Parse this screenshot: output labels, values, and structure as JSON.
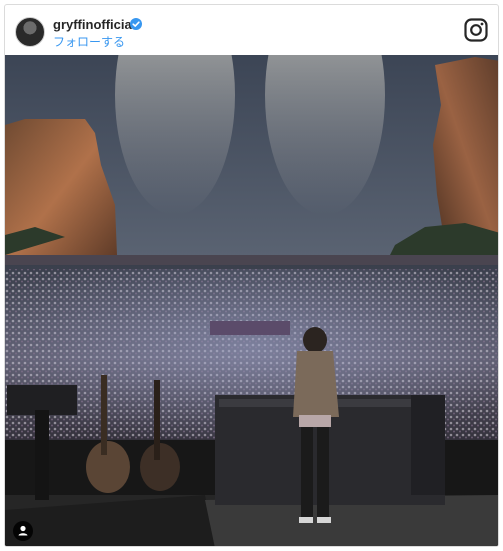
{
  "post": {
    "username": "gryffinofficial",
    "follow_label": "フォローする",
    "verified": true
  },
  "icons": {
    "verified": "verified-badge-icon",
    "brand": "instagram-logo-icon",
    "tag": "user-tag-icon"
  },
  "colors": {
    "accent": "#3897f0",
    "border": "#dbdbdb",
    "text": "#262626"
  }
}
